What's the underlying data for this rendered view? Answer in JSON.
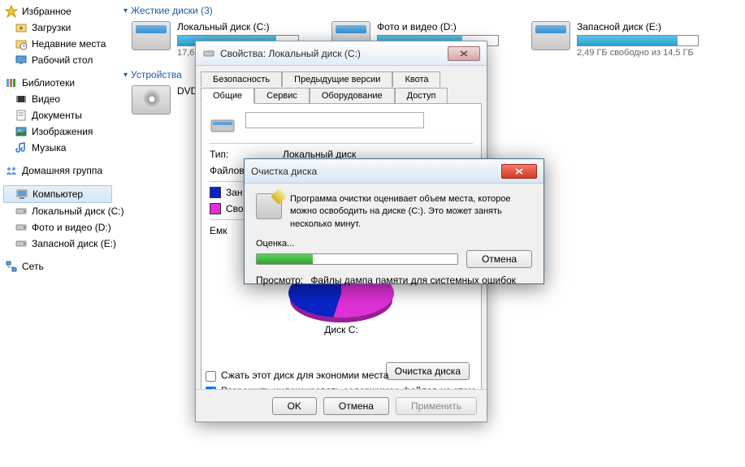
{
  "sidebar": {
    "favorites": {
      "label": "Избранное"
    },
    "downloads": {
      "label": "Загрузки"
    },
    "recent": {
      "label": "Недавние места"
    },
    "desktop": {
      "label": "Рабочий стол"
    },
    "libraries": {
      "label": "Библиотеки"
    },
    "videos": {
      "label": "Видео"
    },
    "documents": {
      "label": "Документы"
    },
    "pictures": {
      "label": "Изображения"
    },
    "music": {
      "label": "Музыка"
    },
    "homegroup": {
      "label": "Домашняя группа"
    },
    "computer": {
      "label": "Компьютер"
    },
    "drive_c": {
      "label": "Локальный диск (C:)"
    },
    "drive_d": {
      "label": "Фото и видео (D:)"
    },
    "drive_e": {
      "label": "Запасной диск (E:)"
    },
    "network": {
      "label": "Сеть"
    }
  },
  "main": {
    "section_hdd": "Жесткие диски (3)",
    "section_removable": "Устройства",
    "drives": [
      {
        "name": "Локальный диск (C:)",
        "free_text": "17,6",
        "fill_pct": 82
      },
      {
        "name": "Фото и видео (D:)",
        "free_text": "",
        "fill_pct": 70
      },
      {
        "name": "Запасной диск (E:)",
        "free_text": "2,49 ГБ свободно из 14,5 ГБ",
        "fill_pct": 83
      }
    ],
    "dvd": {
      "name": "DVD"
    }
  },
  "props": {
    "title": "Свойства: Локальный диск (C:)",
    "tabs_row1": [
      "Безопасность",
      "Предыдущие версии",
      "Квота"
    ],
    "tabs_row2": [
      "Общие",
      "Сервис",
      "Оборудование",
      "Доступ"
    ],
    "active_tab": "Общие",
    "type_lbl": "Тип:",
    "type_val": "Локальный диск",
    "fs_lbl": "Файлов",
    "used_lbl": "Зан",
    "free_lbl": "Сво",
    "cap_lbl": "Емк",
    "pie_lbl": "Диск C:",
    "cleanup_btn": "Очистка диска",
    "chk1": "Сжать этот диск для экономии места",
    "chk2": "Разрешить индексировать содержимое файлов на этом диске в дополнение к свойствам файла",
    "btn_ok": "OK",
    "btn_cancel": "Отмена",
    "btn_apply": "Применить"
  },
  "clean": {
    "title": "Очистка диска",
    "message": "Программа очистки оценивает объем места, которое можно освободить на диске  (C:). Это может занять несколько минут.",
    "progress_lbl": "Оценка...",
    "progress_pct": 28,
    "cancel": "Отмена",
    "scan_lbl": "Просмотр:",
    "scan_val": "Файлы дампа памяти для системных ошибок"
  }
}
